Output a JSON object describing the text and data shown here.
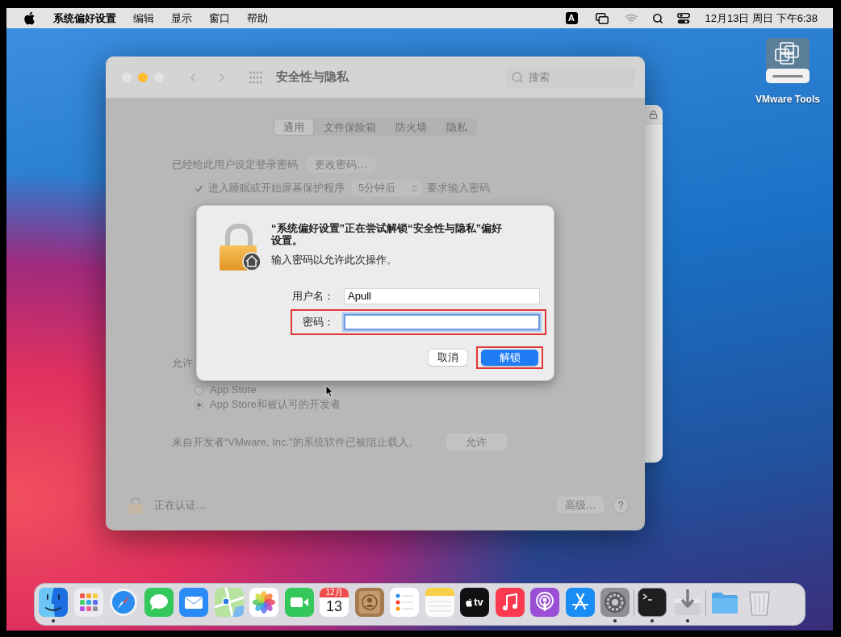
{
  "menu_bar": {
    "menus": [
      {
        "label": "系统偏好设置",
        "kind": "app"
      },
      {
        "label": "编辑",
        "kind": "menu"
      },
      {
        "label": "显示",
        "kind": "menu"
      },
      {
        "label": "窗口",
        "kind": "menu"
      },
      {
        "label": "帮助",
        "kind": "menu"
      }
    ],
    "input_source": "A",
    "clock": "12月13日 周日 下午6:38"
  },
  "desktop_icons": [
    {
      "label": "VMware Tools"
    }
  ],
  "window": {
    "title": "安全性与隐私",
    "traffic_lights": [
      {
        "kind": "close",
        "enabled": false
      },
      {
        "kind": "minimize",
        "enabled": true
      },
      {
        "kind": "zoom",
        "enabled": false
      }
    ],
    "search": {
      "placeholder": "搜索"
    },
    "tabs": [
      {
        "label": "通用",
        "selected": true
      },
      {
        "label": "文件保险箱",
        "selected": false
      },
      {
        "label": "防火墙",
        "selected": false
      },
      {
        "label": "隐私",
        "selected": false
      }
    ],
    "login_password": {
      "text": "已经给此用户设定登录密码",
      "button": "更改密码…"
    },
    "require_password": {
      "label": "进入睡眠或开始屏幕保护程序",
      "checked": true,
      "delay": "5分钟后",
      "suffix": "要求输入密码"
    },
    "allow_apps": {
      "heading": "允许",
      "options": [
        {
          "label": "App Store",
          "selected": false
        },
        {
          "label": "App Store和被认可的开发者",
          "selected": true
        }
      ]
    },
    "blocked_notice": {
      "text": "来自开发者“VMware, Inc.”的系统软件已被阻止载入。",
      "button": "允许"
    },
    "footer": {
      "status": "正在认证…",
      "advanced_button": "高级…",
      "help_button": "?"
    }
  },
  "dialog": {
    "message": "“系统偏好设置”正在尝试解锁“安全性与隐私”偏好设置。",
    "prompt": "输入密码以允许此次操作。",
    "fields": [
      {
        "label": "用户名：",
        "value": "Apull",
        "focused": false,
        "highlighted": false
      },
      {
        "label": "密码：",
        "focused": true,
        "highlighted": true
      }
    ],
    "buttons": [
      {
        "label": "取消",
        "kind": "cancel",
        "highlighted": false
      },
      {
        "label": "解锁",
        "kind": "default",
        "highlighted": true
      }
    ]
  },
  "dock": {
    "sections": [
      {
        "items": [
          {
            "kind": "finder",
            "running": true
          },
          {
            "kind": "launchpad",
            "running": false
          },
          {
            "kind": "safari",
            "running": false
          },
          {
            "kind": "messages",
            "running": false
          },
          {
            "kind": "mail",
            "running": false
          },
          {
            "kind": "maps",
            "running": false
          },
          {
            "kind": "photos",
            "running": false
          },
          {
            "kind": "facetime",
            "running": false
          },
          {
            "kind": "calendar",
            "month": "12月",
            "day": "13",
            "running": false
          },
          {
            "kind": "contacts",
            "running": false
          },
          {
            "kind": "reminders",
            "running": false
          },
          {
            "kind": "notes",
            "running": false
          },
          {
            "kind": "tv",
            "label": "tv",
            "running": false
          },
          {
            "kind": "music",
            "running": false
          },
          {
            "kind": "podcasts",
            "running": false
          },
          {
            "kind": "appstore",
            "running": false
          },
          {
            "kind": "preferences",
            "running": true
          }
        ]
      },
      {
        "items": [
          {
            "kind": "terminal",
            "running": true
          },
          {
            "kind": "installer",
            "running": true
          }
        ]
      },
      {
        "items": [
          {
            "kind": "folder",
            "running": false
          },
          {
            "kind": "trash",
            "running": false
          }
        ]
      }
    ]
  }
}
